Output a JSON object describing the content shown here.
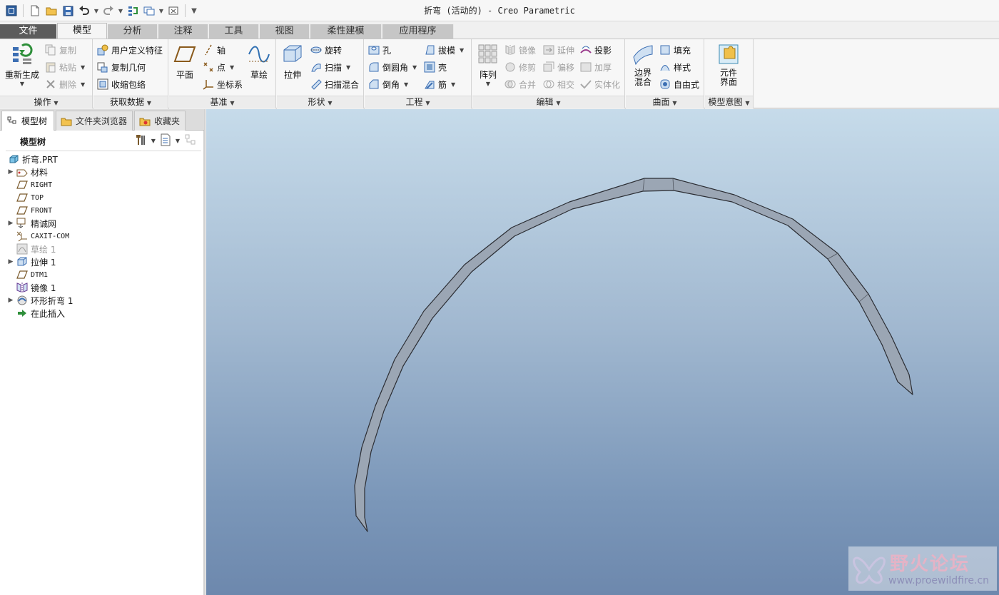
{
  "window": {
    "title": "折弯 (活动的) - Creo Parametric"
  },
  "quick_access": {
    "icons": [
      "app-icon",
      "new-icon",
      "open-icon",
      "save-icon",
      "undo-icon",
      "redo-icon",
      "regenerate-icon",
      "windows-icon",
      "close-window-icon",
      "customize-icon"
    ]
  },
  "ribbon_tabs": [
    "文件",
    "模型",
    "分析",
    "注释",
    "工具",
    "视图",
    "柔性建模",
    "应用程序"
  ],
  "ribbon": {
    "operations": {
      "label": "操作",
      "regen": "重新生成",
      "copy": "复制",
      "paste": "粘贴",
      "delete": "删除"
    },
    "get_data": {
      "label": "获取数据",
      "udf": "用户定义特征",
      "copy_geom": "复制几何",
      "shrinkwrap": "收缩包络"
    },
    "datum": {
      "label": "基准",
      "plane": "平面",
      "axis": "轴",
      "point": "点",
      "csys": "坐标系",
      "sketch": "草绘"
    },
    "shapes": {
      "label": "形状",
      "extrude": "拉伸",
      "revolve": "旋转",
      "sweep": "扫描",
      "swept_blend": "扫描混合"
    },
    "engineering": {
      "label": "工程",
      "hole": "孔",
      "round": "倒圆角",
      "chamfer": "倒角",
      "draft": "拔模",
      "shell": "壳",
      "rib": "筋"
    },
    "editing": {
      "label": "编辑",
      "pattern": "阵列",
      "mirror": "镜像",
      "trim": "修剪",
      "merge": "合并",
      "extend": "延伸",
      "offset": "偏移",
      "intersect": "相交",
      "project": "投影",
      "thicken": "加厚",
      "solidify": "实体化"
    },
    "surfaces": {
      "label": "曲面",
      "boundary_line1": "边界",
      "boundary_line2": "混合",
      "fill": "填充",
      "style": "样式",
      "freestyle": "自由式"
    },
    "model_intent": {
      "label": "模型意图",
      "component_line1": "元件",
      "component_line2": "界面"
    }
  },
  "panel": {
    "tabs": [
      "模型树",
      "文件夹浏览器",
      "收藏夹"
    ],
    "tree_title": "模型树",
    "tree": [
      {
        "label": "折弯.PRT",
        "icon": "part-icon",
        "expand": false,
        "mono": false,
        "dim": false,
        "indent": 0
      },
      {
        "label": "材料",
        "icon": "material-icon",
        "expand": true,
        "mono": false,
        "dim": false,
        "indent": 1
      },
      {
        "label": "RIGHT",
        "icon": "datum-plane-icon",
        "expand": false,
        "mono": true,
        "dim": false,
        "indent": 1
      },
      {
        "label": "TOP",
        "icon": "datum-plane-icon",
        "expand": false,
        "mono": true,
        "dim": false,
        "indent": 1
      },
      {
        "label": "FRONT",
        "icon": "datum-plane-icon",
        "expand": false,
        "mono": true,
        "dim": false,
        "indent": 1
      },
      {
        "label": "精诚网",
        "icon": "layer-icon",
        "expand": true,
        "mono": false,
        "dim": false,
        "indent": 1
      },
      {
        "label": "CAXIT-COM",
        "icon": "csys-icon",
        "expand": false,
        "mono": true,
        "dim": false,
        "indent": 1
      },
      {
        "label": "草绘 1",
        "icon": "sketch-icon",
        "expand": false,
        "mono": false,
        "dim": true,
        "indent": 1
      },
      {
        "label": "拉伸 1",
        "icon": "extrude-icon",
        "expand": true,
        "mono": false,
        "dim": false,
        "indent": 1
      },
      {
        "label": "DTM1",
        "icon": "datum-plane-icon",
        "expand": false,
        "mono": true,
        "dim": false,
        "indent": 1
      },
      {
        "label": "镜像 1",
        "icon": "mirror-icon",
        "expand": false,
        "mono": false,
        "dim": false,
        "indent": 1
      },
      {
        "label": "环形折弯 1",
        "icon": "toroidal-bend-icon",
        "expand": true,
        "mono": false,
        "dim": false,
        "indent": 1
      },
      {
        "label": "在此插入",
        "icon": "insert-here-icon",
        "expand": false,
        "mono": false,
        "dim": false,
        "indent": 1
      }
    ]
  },
  "watermark": {
    "title": "野火论坛",
    "url": "www.proewildfire.cn"
  },
  "colors": {
    "file_tab": "#5c5c5c",
    "viewport_top": "#c6dbea",
    "viewport_bottom": "#6d88ad",
    "model_fill": "#9ba6b4"
  }
}
